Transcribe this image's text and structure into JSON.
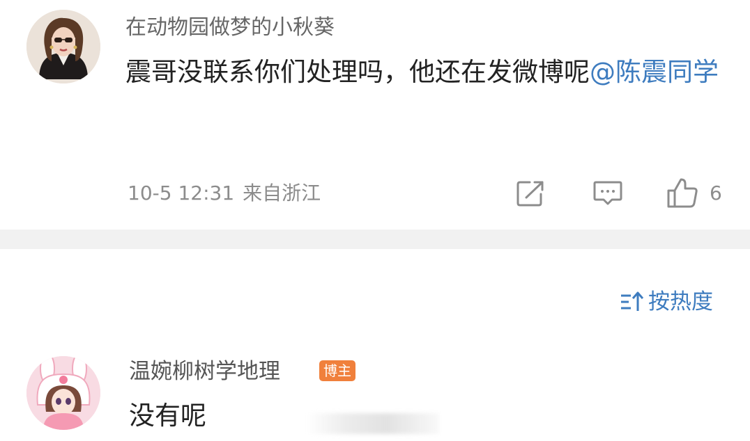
{
  "first_comment": {
    "username": "在动物园做梦的小秋葵",
    "text": "震哥没联系你们处理吗，他还在发微博呢",
    "mention": "@陈震同学",
    "date": "10-5 12:31",
    "location": "来自浙江",
    "like_count": "6",
    "icons": [
      "share-icon",
      "comment-icon",
      "like-icon"
    ]
  },
  "sort": {
    "label": "按热度",
    "icon": "sort-icon"
  },
  "second_comment": {
    "username": "温婉柳树学地理",
    "badge": "博主",
    "text": "没有呢"
  },
  "colors": {
    "link": "#3e7cbf",
    "badge": "#f0803c",
    "meta": "#8c8c8c",
    "divider": "#f1f1f1"
  }
}
